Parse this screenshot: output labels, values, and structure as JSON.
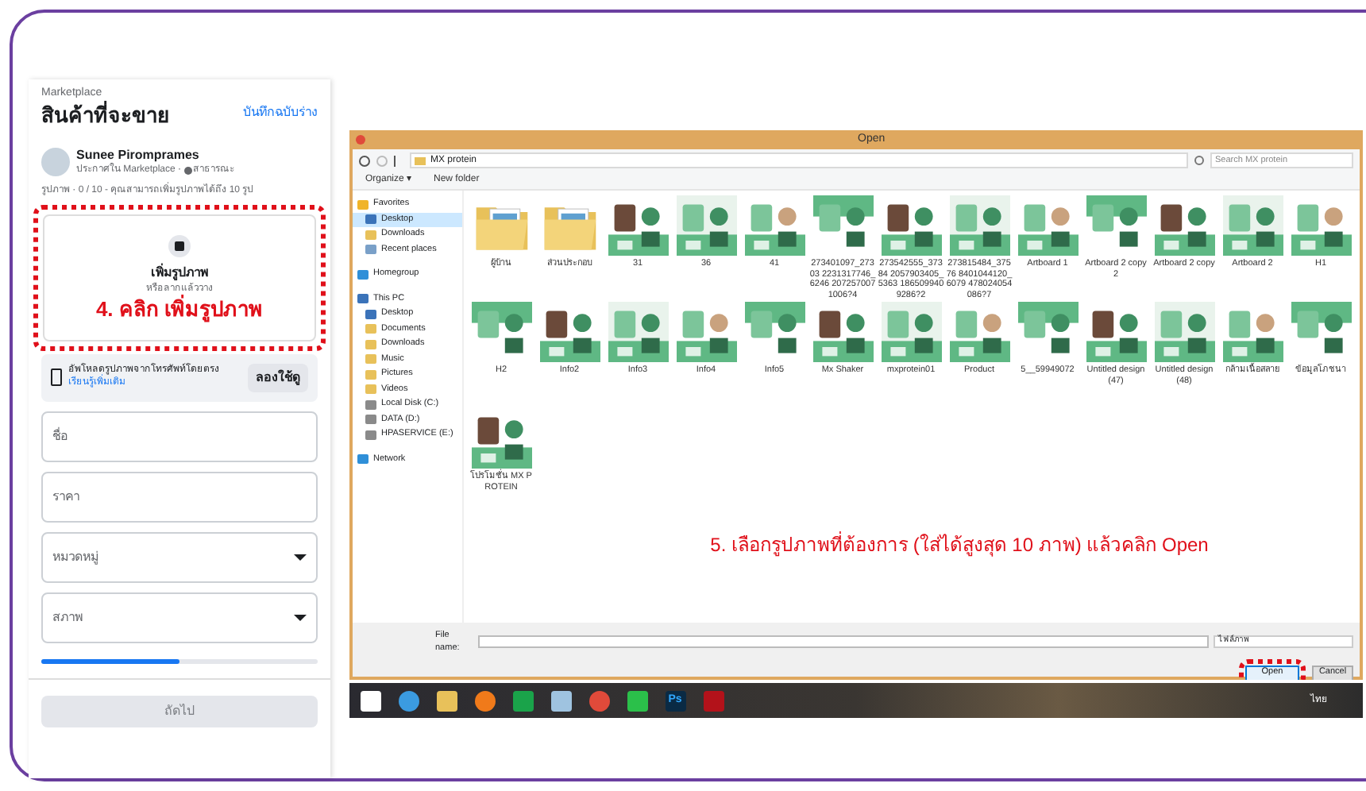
{
  "marketplace": {
    "breadcrumb": "Marketplace",
    "title": "สินค้าที่จะขาย",
    "save_draft": "บันทึกฉบับร่าง",
    "seller": {
      "name": "Sunee Piromprames",
      "posted_in": "ประกาศใน Marketplace · ",
      "audience": "สาธารณะ"
    },
    "photos_note": "รูปภาพ · 0 / 10 - คุณสามารถเพิ่มรูปภาพได้ถึง 10 รูป",
    "upload": {
      "title": "เพิ่มรูปภาพ",
      "hint": "หรือลากแล้ววาง"
    },
    "callout_1": "4. คลิก เพิ่มรูปภาพ",
    "phone_upload": {
      "text": "อัพโหลดรูปภาพจากโทรศัพท์โดยตรง ",
      "link": "เรียนรู้เพิ่มเติม",
      "button": "ลองใช้ดู"
    },
    "fields": [
      {
        "kind": "text",
        "placeholder": "ชื่อ"
      },
      {
        "kind": "text",
        "placeholder": "ราคา"
      },
      {
        "kind": "select",
        "placeholder": "หมวดหมู่"
      },
      {
        "kind": "select",
        "placeholder": "สภาพ"
      }
    ],
    "progress": {
      "level": 0.5
    },
    "next_button": {
      "label": "ถัดไป",
      "disabled": true
    }
  },
  "dialog": {
    "title": "Open",
    "path": [
      "MX protein"
    ],
    "search": {
      "placeholder": "Search MX protein"
    },
    "toolbar": [
      "Organize ▾",
      "New folder"
    ],
    "nav": [
      {
        "label": "Favorites",
        "kind": "star",
        "selected": false,
        "children": [
          {
            "label": "Desktop",
            "kind": "desktop",
            "selected": true
          },
          {
            "label": "Downloads",
            "kind": "folder",
            "selected": false
          },
          {
            "label": "Recent places",
            "kind": "recent",
            "selected": false
          }
        ]
      },
      {
        "label": "Homegroup",
        "kind": "homegroup",
        "selected": false
      },
      {
        "label": "This PC",
        "kind": "pc",
        "selected": false,
        "children": [
          {
            "label": "Desktop",
            "kind": "desktop",
            "selected": false
          },
          {
            "label": "Documents",
            "kind": "folder",
            "selected": false
          },
          {
            "label": "Downloads",
            "kind": "folder",
            "selected": false
          },
          {
            "label": "Music",
            "kind": "folder",
            "selected": false
          },
          {
            "label": "Pictures",
            "kind": "folder",
            "selected": false
          },
          {
            "label": "Videos",
            "kind": "folder",
            "selected": false
          },
          {
            "label": "Local Disk (C:)",
            "kind": "drive",
            "selected": false
          },
          {
            "label": "DATA (D:)",
            "kind": "drive",
            "selected": false
          },
          {
            "label": "HPASERVICE (E:)",
            "kind": "drive",
            "selected": false
          }
        ]
      },
      {
        "label": "Network",
        "kind": "network",
        "selected": false
      }
    ],
    "files": [
      {
        "name": "ผู้บ้าน",
        "kind": "folder"
      },
      {
        "name": "ส่วนประกอบ",
        "kind": "folder"
      },
      {
        "name": "31"
      },
      {
        "name": "36"
      },
      {
        "name": "41"
      },
      {
        "name": "273401097_27303 2231317746_6246 2072570071006?4"
      },
      {
        "name": "273542555_37384 2057903405_5363 1865099409286?2"
      },
      {
        "name": "273815484_37576 8401044120_6079 478024054086?7"
      },
      {
        "name": "Artboard 1"
      },
      {
        "name": "Artboard 2 copy 2"
      },
      {
        "name": "Artboard 2 copy"
      },
      {
        "name": "Artboard 2"
      },
      {
        "name": "H1"
      },
      {
        "name": "H2"
      },
      {
        "name": "Info2"
      },
      {
        "name": "Info3"
      },
      {
        "name": "Info4"
      },
      {
        "name": "Info5"
      },
      {
        "name": "Mx Shaker"
      },
      {
        "name": "mxprotein01"
      },
      {
        "name": "Product"
      },
      {
        "name": "5__59949072"
      },
      {
        "name": "Untitled design (47)"
      },
      {
        "name": "Untitled design (48)"
      },
      {
        "name": "กล้ามเนื้อสลาย"
      },
      {
        "name": "ข้อมูลโภชนา"
      },
      {
        "name": "โปรโมชั่น MX PROTEIN"
      }
    ],
    "callout_2": "5. เลือกรูปภาพที่ต้องการ (ใส่ได้สูงสุด 10 ภาพ) แล้วคลิก Open",
    "file_name_label": "File name:",
    "file_type": "ไฟล์ภาพ",
    "open_button": "Open",
    "cancel_button": "Cancel"
  },
  "taskbar": {
    "apps": [
      {
        "kind": "start"
      },
      {
        "kind": "ie"
      },
      {
        "kind": "explorer"
      },
      {
        "kind": "firefox"
      },
      {
        "kind": "store"
      },
      {
        "kind": "notes"
      },
      {
        "kind": "chrome"
      },
      {
        "kind": "line"
      },
      {
        "kind": "photoshop",
        "label": "Ps"
      },
      {
        "kind": "acrobat"
      }
    ],
    "language": "ไทย"
  }
}
